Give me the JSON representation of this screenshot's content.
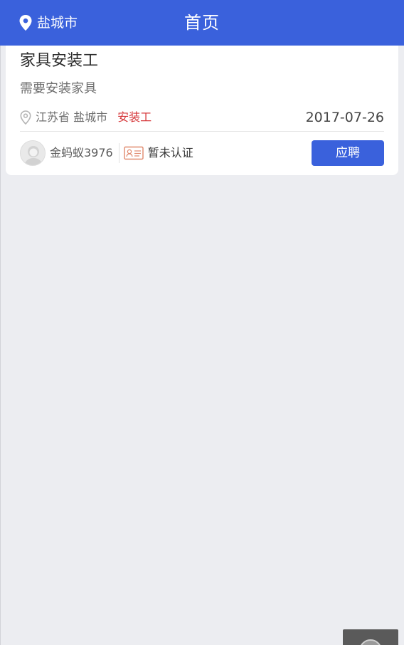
{
  "colors": {
    "primary": "#3a61dc",
    "tag_red": "#d6373a",
    "background": "#ecedf1"
  },
  "header": {
    "city": "盐城市",
    "title": "首页",
    "location_icon": "location-pin-icon"
  },
  "job_card": {
    "title": "家具安装工",
    "description": "需要安装家具",
    "region": "江苏省 盐城市",
    "tag": "安装工",
    "date": "2017-07-26",
    "location_icon": "location-pin-icon",
    "publisher": {
      "name": "金蚂蚁3976",
      "avatar_icon": "default-avatar-icon",
      "certification_icon": "id-card-icon",
      "certification_status": "暂未认证"
    },
    "apply_label": "应聘"
  }
}
